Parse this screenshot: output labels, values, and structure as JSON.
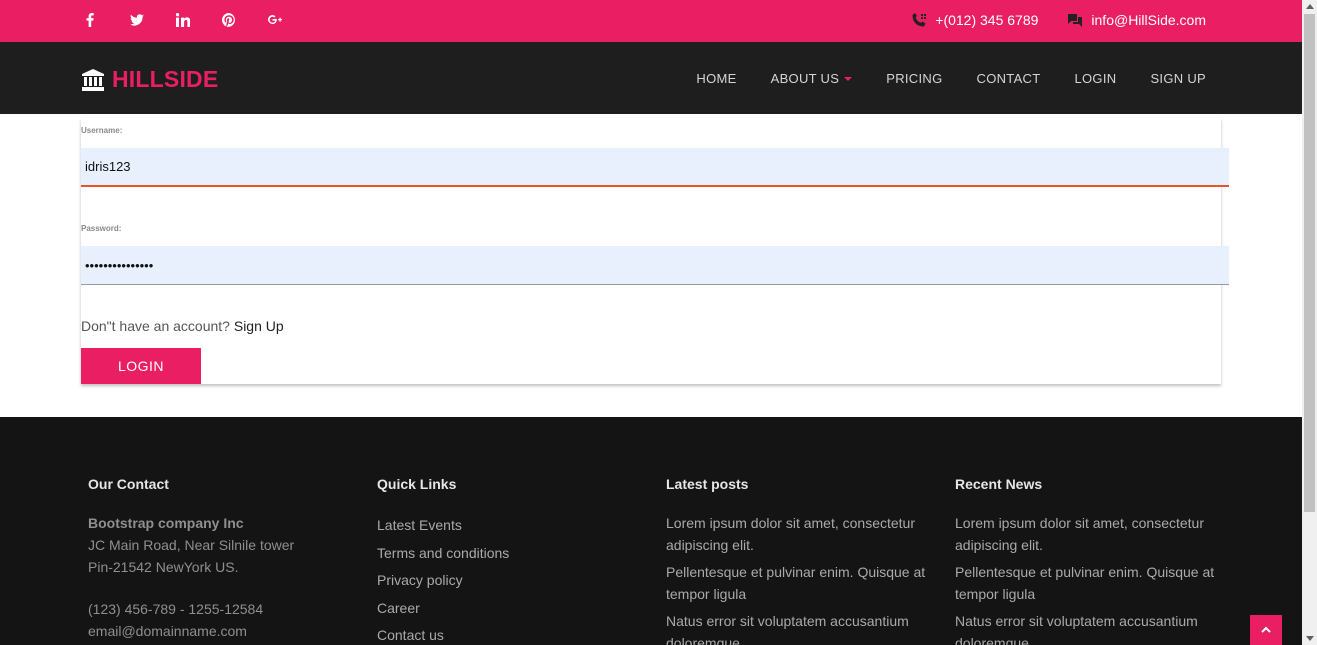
{
  "topbar": {
    "social": [
      "facebook-icon",
      "twitter-icon",
      "linkedin-icon",
      "pinterest-icon",
      "google-plus-icon"
    ],
    "phone": "+(012) 345 6789",
    "email": "info@HillSide.com"
  },
  "nav": {
    "brand": "HILLSIDE",
    "items": [
      "HOME",
      "ABOUT US",
      "PRICING",
      "CONTACT",
      "LOGIN",
      "SIGN UP"
    ]
  },
  "login": {
    "username_label": "Username:",
    "username_value": "idris123",
    "password_label": "Password:",
    "password_value": "•••••••••••••••",
    "no_account_text": "Don\"t have an account?",
    "signup_link": "Sign Up",
    "login_button": "LOGIN"
  },
  "footer": {
    "contact": {
      "title": "Our Contact",
      "company": "Bootstrap company Inc",
      "address1": "JC Main Road, Near Silnile tower",
      "address2": "Pin-21542 NewYork US.",
      "phone": "(123) 456-789 - 1255-12584",
      "email": "email@domainname.com"
    },
    "quick_links": {
      "title": "Quick Links",
      "items": [
        "Latest Events",
        "Terms and conditions",
        "Privacy policy",
        "Career",
        "Contact us"
      ]
    },
    "latest_posts": {
      "title": "Latest posts",
      "items": [
        "Lorem ipsum dolor sit amet, consectetur adipiscing elit.",
        "Pellentesque et pulvinar enim. Quisque at tempor ligula",
        "Natus error sit voluptatem accusantium doloremque"
      ]
    },
    "recent_news": {
      "title": "Recent News",
      "items": [
        "Lorem ipsum dolor sit amet, consectetur adipiscing elit.",
        "Pellentesque et pulvinar enim. Quisque at tempor ligula",
        "Natus error sit voluptatem accusantium doloremque"
      ]
    }
  },
  "colors": {
    "accent": "#e91e63",
    "nav_bg": "#1e1e1e",
    "footer_bg": "#141414",
    "input_bg": "#e8f0fe"
  }
}
